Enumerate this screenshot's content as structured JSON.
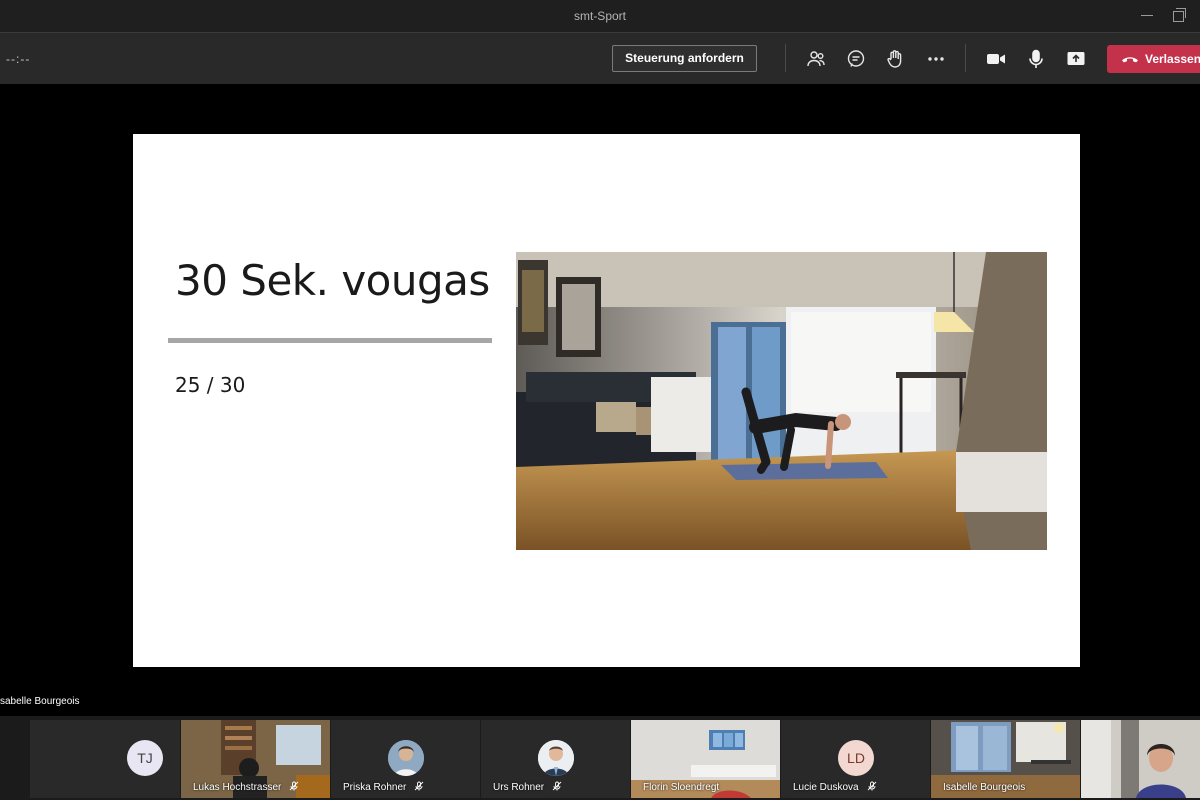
{
  "window": {
    "title": "smt-Sport"
  },
  "toolbar": {
    "timer": "--:--",
    "request_control_label": "Steuerung anfordern",
    "leave_label": "Verlassen",
    "icons": [
      "participants-icon",
      "chat-icon",
      "raise-hand-icon",
      "more-options-icon",
      "camera-icon",
      "microphone-icon",
      "share-screen-icon",
      "hang-up-icon"
    ]
  },
  "slide": {
    "title": "30 Sek. vougas",
    "counter": "25 / 30"
  },
  "presenter": {
    "name": "sabelle Bourgeois"
  },
  "participants": [
    {
      "initials": "TJ",
      "name": "",
      "type": "initials"
    },
    {
      "initials": "",
      "name": "Lukas Hochstrasser",
      "type": "video",
      "muted": true
    },
    {
      "initials": "",
      "name": "Priska Rohner",
      "type": "photo",
      "muted": true
    },
    {
      "initials": "",
      "name": "Urs Rohner",
      "type": "photo",
      "muted": true
    },
    {
      "initials": "",
      "name": "Florin Sloendregt",
      "type": "video",
      "muted": false
    },
    {
      "initials": "LD",
      "name": "Lucie Duskova",
      "type": "initials",
      "muted": true
    },
    {
      "initials": "",
      "name": "Isabelle Bourgeois",
      "type": "video",
      "muted": false
    },
    {
      "initials": "",
      "name": "",
      "type": "video"
    }
  ],
  "colors": {
    "leave": "#c4314b",
    "toolbar": "#292929",
    "titlebar": "#1f1f1f",
    "avatar_tj": "#e8e6f2",
    "avatar_ld": "#f3d8d1"
  }
}
